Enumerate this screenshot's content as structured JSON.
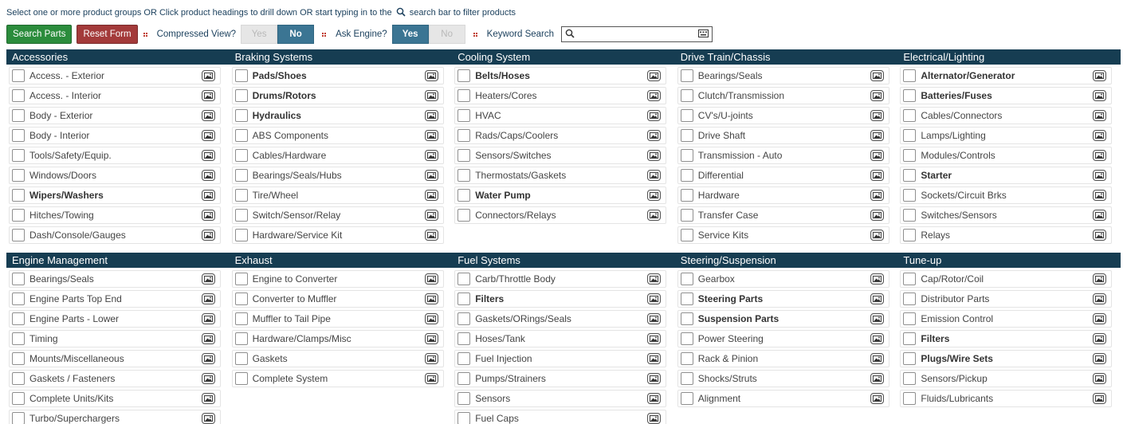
{
  "instructions": {
    "before": "Select one or more product groups OR Click product headings to drill down OR start typing in to the",
    "after": "search bar to filter products"
  },
  "toolbar": {
    "search_parts": "Search Parts",
    "reset_form": "Reset Form",
    "compressed_view_label": "Compressed View?",
    "compressed_yes": "Yes",
    "compressed_no": "No",
    "compressed_selected": "No",
    "ask_engine_label": "Ask Engine?",
    "ask_yes": "Yes",
    "ask_no": "No",
    "ask_selected": "Yes",
    "keyword_label": "Keyword Search",
    "keyword_value": ""
  },
  "colors": {
    "header_bg": "#163d52",
    "green": "#2b8c3c",
    "red": "#a33a3a",
    "toggle_on": "#3b7593"
  },
  "sections": [
    {
      "groups": [
        {
          "heading": "Accessories",
          "items": [
            {
              "label": "Access. - Exterior",
              "bold": false
            },
            {
              "label": "Access. - Interior",
              "bold": false
            },
            {
              "label": "Body - Exterior",
              "bold": false
            },
            {
              "label": "Body - Interior",
              "bold": false
            },
            {
              "label": "Tools/Safety/Equip.",
              "bold": false
            },
            {
              "label": "Windows/Doors",
              "bold": false
            },
            {
              "label": "Wipers/Washers",
              "bold": true
            },
            {
              "label": "Hitches/Towing",
              "bold": false
            },
            {
              "label": "Dash/Console/Gauges",
              "bold": false
            }
          ]
        },
        {
          "heading": "Braking Systems",
          "items": [
            {
              "label": "Pads/Shoes",
              "bold": true
            },
            {
              "label": "Drums/Rotors",
              "bold": true
            },
            {
              "label": "Hydraulics",
              "bold": true
            },
            {
              "label": "ABS Components",
              "bold": false
            },
            {
              "label": "Cables/Hardware",
              "bold": false
            },
            {
              "label": "Bearings/Seals/Hubs",
              "bold": false
            },
            {
              "label": "Tire/Wheel",
              "bold": false
            },
            {
              "label": "Switch/Sensor/Relay",
              "bold": false
            },
            {
              "label": "Hardware/Service Kit",
              "bold": false
            }
          ]
        },
        {
          "heading": "Cooling System",
          "items": [
            {
              "label": "Belts/Hoses",
              "bold": true
            },
            {
              "label": "Heaters/Cores",
              "bold": false
            },
            {
              "label": "HVAC",
              "bold": false
            },
            {
              "label": "Rads/Caps/Coolers",
              "bold": false
            },
            {
              "label": "Sensors/Switches",
              "bold": false
            },
            {
              "label": "Thermostats/Gaskets",
              "bold": false
            },
            {
              "label": "Water Pump",
              "bold": true
            },
            {
              "label": "Connectors/Relays",
              "bold": false
            }
          ]
        },
        {
          "heading": "Drive Train/Chassis",
          "items": [
            {
              "label": "Bearings/Seals",
              "bold": false
            },
            {
              "label": "Clutch/Transmission",
              "bold": false
            },
            {
              "label": "CV's/U-joints",
              "bold": false
            },
            {
              "label": "Drive Shaft",
              "bold": false
            },
            {
              "label": "Transmission - Auto",
              "bold": false
            },
            {
              "label": "Differential",
              "bold": false
            },
            {
              "label": "Hardware",
              "bold": false
            },
            {
              "label": "Transfer Case",
              "bold": false
            },
            {
              "label": "Service Kits",
              "bold": false
            }
          ]
        },
        {
          "heading": "Electrical/Lighting",
          "items": [
            {
              "label": "Alternator/Generator",
              "bold": true
            },
            {
              "label": "Batteries/Fuses",
              "bold": true
            },
            {
              "label": "Cables/Connectors",
              "bold": false
            },
            {
              "label": "Lamps/Lighting",
              "bold": false
            },
            {
              "label": "Modules/Controls",
              "bold": false
            },
            {
              "label": "Starter",
              "bold": true
            },
            {
              "label": "Sockets/Circuit Brks",
              "bold": false
            },
            {
              "label": "Switches/Sensors",
              "bold": false
            },
            {
              "label": "Relays",
              "bold": false
            }
          ]
        }
      ]
    },
    {
      "groups": [
        {
          "heading": "Engine Management",
          "items": [
            {
              "label": "Bearings/Seals",
              "bold": false
            },
            {
              "label": "Engine Parts Top End",
              "bold": false
            },
            {
              "label": "Engine Parts - Lower",
              "bold": false
            },
            {
              "label": "Timing",
              "bold": false
            },
            {
              "label": "Mounts/Miscellaneous",
              "bold": false
            },
            {
              "label": "Gaskets / Fasteners",
              "bold": false
            },
            {
              "label": "Complete Units/Kits",
              "bold": false
            },
            {
              "label": "Turbo/Superchargers",
              "bold": false
            }
          ]
        },
        {
          "heading": "Exhaust",
          "items": [
            {
              "label": "Engine to Converter",
              "bold": false
            },
            {
              "label": "Converter to Muffler",
              "bold": false
            },
            {
              "label": "Muffler to Tail Pipe",
              "bold": false
            },
            {
              "label": "Hardware/Clamps/Misc",
              "bold": false
            },
            {
              "label": "Gaskets",
              "bold": false
            },
            {
              "label": "Complete System",
              "bold": false
            }
          ]
        },
        {
          "heading": "Fuel Systems",
          "items": [
            {
              "label": "Carb/Throttle Body",
              "bold": false
            },
            {
              "label": "Filters",
              "bold": true
            },
            {
              "label": "Gaskets/ORings/Seals",
              "bold": false
            },
            {
              "label": "Hoses/Tank",
              "bold": false
            },
            {
              "label": "Fuel Injection",
              "bold": false
            },
            {
              "label": "Pumps/Strainers",
              "bold": false
            },
            {
              "label": "Sensors",
              "bold": false
            },
            {
              "label": "Fuel Caps",
              "bold": false
            }
          ]
        },
        {
          "heading": "Steering/Suspension",
          "items": [
            {
              "label": "Gearbox",
              "bold": false
            },
            {
              "label": "Steering Parts",
              "bold": true
            },
            {
              "label": "Suspension Parts",
              "bold": true
            },
            {
              "label": "Power Steering",
              "bold": false
            },
            {
              "label": "Rack & Pinion",
              "bold": false
            },
            {
              "label": "Shocks/Struts",
              "bold": false
            },
            {
              "label": "Alignment",
              "bold": false
            }
          ]
        },
        {
          "heading": "Tune-up",
          "items": [
            {
              "label": "Cap/Rotor/Coil",
              "bold": false
            },
            {
              "label": "Distributor Parts",
              "bold": false
            },
            {
              "label": "Emission Control",
              "bold": false
            },
            {
              "label": "Filters",
              "bold": true
            },
            {
              "label": "Plugs/Wire Sets",
              "bold": true
            },
            {
              "label": "Sensors/Pickup",
              "bold": false
            },
            {
              "label": "Fluids/Lubricants",
              "bold": false
            }
          ]
        }
      ]
    }
  ]
}
